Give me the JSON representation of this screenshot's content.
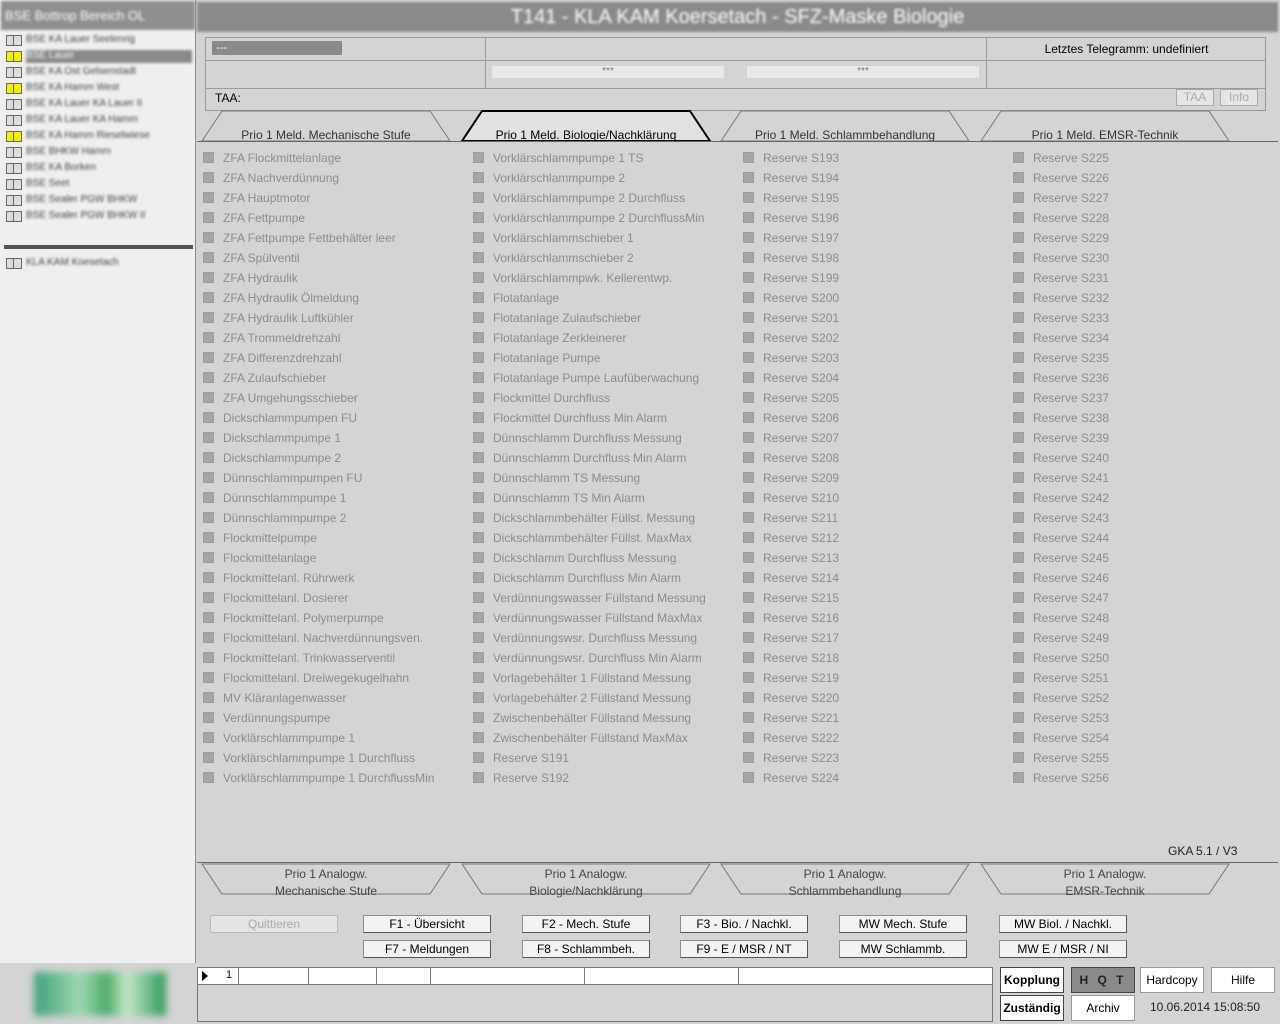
{
  "nav": {
    "header": "BSE Bottrop Bereich OL",
    "items": [
      {
        "label": "BSE KA Lauer Seelenrig",
        "state": "normal"
      },
      {
        "label": "BSE Lauer",
        "state": "selected-warning"
      },
      {
        "label": "BSE KA Ost Gelsenstadt",
        "state": "normal"
      },
      {
        "label": "BSE KA Hamm West",
        "state": "warning"
      },
      {
        "label": "BSE KA Lauer KA Lauer II",
        "state": "normal"
      },
      {
        "label": "BSE KA Lauer KA Hamm",
        "state": "normal"
      },
      {
        "label": "BSE KA Hamm Rieselwiese",
        "state": "warning"
      },
      {
        "label": "BSE BHKW Hamm",
        "state": "normal"
      },
      {
        "label": "BSE KA Borken",
        "state": "normal"
      },
      {
        "label": "BSE Seet",
        "state": "normal"
      },
      {
        "label": "BSE Sealer PGW BHKW",
        "state": "normal"
      },
      {
        "label": "BSE Sealer PGW BHKW II",
        "state": "normal"
      }
    ],
    "extra_item": "KLA KAM Koesetach"
  },
  "window_title": "T141 - KLA KAM Koersetach - SFZ-Maske Biologie",
  "info": {
    "field1": "---",
    "telegram": "Letztes Telegramm: undefiniert",
    "star1": "***",
    "star2": "***",
    "taa_label": "TAA:",
    "taa_button": "TAA",
    "info_button": "Info"
  },
  "tabs_top": [
    {
      "label": "Prio 1 Meld. Mechanische Stufe",
      "active": false
    },
    {
      "label": "Prio 1 Meld. Biologie/Nachklärung",
      "active": true
    },
    {
      "label": "Prio 1 Meld. Schlammbehandlung",
      "active": false
    },
    {
      "label": "Prio 1 Meld. EMSR-Technik",
      "active": false
    }
  ],
  "columns": [
    [
      "ZFA Flockmittelanlage",
      "ZFA Nachverdünnung",
      "ZFA Hauptmotor",
      "ZFA Fettpumpe",
      "ZFA Fettpumpe Fettbehälter leer",
      "ZFA Spülventil",
      "ZFA Hydraulik",
      "ZFA Hydraulik Ölmeldung",
      "ZFA Hydraulik Luftkühler",
      "ZFA Trommeldrehzahl",
      "ZFA Differenzdrehzahl",
      "ZFA Zulaufschieber",
      "ZFA Umgehungsschieber",
      "Dickschlammpumpen FU",
      "Dickschlammpumpe 1",
      "Dickschlammpumpe 2",
      "Dünnschlammpumpen FU",
      "Dünnschlammpumpe 1",
      "Dünnschlammpumpe 2",
      "Flockmittelpumpe",
      "Flockmittelanlage",
      "Flockmittelanl. Rührwerk",
      "Flockmittelanl. Dosierer",
      "Flockmittelanl. Polymerpumpe",
      "Flockmittelanl. Nachverdünnungsven.",
      "Flockmittelanl. Trinkwasserventil",
      "Flockmittelanl. Dreiwegekugelhahn",
      "MV Kläranlagenwasser",
      "Verdünnungspumpe",
      "Vorklärschlammpumpe 1",
      "Vorklärschlammpumpe 1 Durchfluss",
      "Vorklärschlammpumpe 1 DurchflussMin"
    ],
    [
      "Vorklärschlammpumpe 1 TS",
      "Vorklärschlammpumpe 2",
      "Vorklärschlammpumpe 2 Durchfluss",
      "Vorklärschlammpumpe 2 DurchflussMin",
      "Vorklärschlammschieber 1",
      "Vorklärschlammschieber 2",
      "Vorklärschlammpwk. Kellerentwp.",
      "Flotatanlage",
      "Flotatanlage Zulaufschieber",
      "Flotatanlage Zerkleinerer",
      "Flotatanlage Pumpe",
      "Flotatanlage Pumpe Laufüberwachung",
      "Flockmittel Durchfluss",
      "Flockmittel Durchfluss Min Alarm",
      "Dünnschlamm Durchfluss Messung",
      "Dünnschlamm Durchfluss Min Alarm",
      "Dünnschlamm TS Messung",
      "Dünnschlamm TS Min Alarm",
      "Dickschlammbehälter Füllst. Messung",
      "Dickschlammbehälter Füllst. MaxMax",
      "Dickschlamm Durchfluss Messung",
      "Dickschlamm Durchfluss Min Alarm",
      "Verdünnungswasser Füllstand Messung",
      "Verdünnungswasser Füllstand MaxMax",
      "Verdünnungswsr. Durchfluss Messung",
      "Verdünnungswsr. Durchfluss Min Alarm",
      "Vorlagebehälter 1 Füllstand Messung",
      "Vorlagebehälter 2 Füllstand Messung",
      "Zwischenbehälter Füllstand Messung",
      "Zwischenbehälter Füllstand MaxMax",
      "Reserve S191",
      "Reserve S192"
    ],
    [
      "Reserve S193",
      "Reserve S194",
      "Reserve S195",
      "Reserve S196",
      "Reserve S197",
      "Reserve S198",
      "Reserve S199",
      "Reserve S200",
      "Reserve S201",
      "Reserve S202",
      "Reserve S203",
      "Reserve S204",
      "Reserve S205",
      "Reserve S206",
      "Reserve S207",
      "Reserve S208",
      "Reserve S209",
      "Reserve S210",
      "Reserve S211",
      "Reserve S212",
      "Reserve S213",
      "Reserve S214",
      "Reserve S215",
      "Reserve S216",
      "Reserve S217",
      "Reserve S218",
      "Reserve S219",
      "Reserve S220",
      "Reserve S221",
      "Reserve S222",
      "Reserve S223",
      "Reserve S224"
    ],
    [
      "Reserve S225",
      "Reserve S226",
      "Reserve S227",
      "Reserve S228",
      "Reserve S229",
      "Reserve S230",
      "Reserve S231",
      "Reserve S232",
      "Reserve S233",
      "Reserve S234",
      "Reserve S235",
      "Reserve S236",
      "Reserve S237",
      "Reserve S238",
      "Reserve S239",
      "Reserve S240",
      "Reserve S241",
      "Reserve S242",
      "Reserve S243",
      "Reserve S244",
      "Reserve S245",
      "Reserve S246",
      "Reserve S247",
      "Reserve S248",
      "Reserve S249",
      "Reserve S250",
      "Reserve S251",
      "Reserve S252",
      "Reserve S253",
      "Reserve S254",
      "Reserve S255",
      "Reserve S256"
    ]
  ],
  "version": "GKA 5.1 / V3",
  "tabs_bottom": [
    {
      "line1": "Prio 1 Analogw.",
      "line2": "Mechanische Stufe"
    },
    {
      "line1": "Prio 1 Analogw.",
      "line2": "Biologie/Nachklärung"
    },
    {
      "line1": "Prio 1 Analogw.",
      "line2": "Schlammbehandlung"
    },
    {
      "line1": "Prio 1 Analogw.",
      "line2": "EMSR-Technik"
    }
  ],
  "buttons": {
    "quit": "Quittieren",
    "f1": "F1 - Übersicht",
    "f2": "F2 - Mech. Stufe",
    "f3": "F3 - Bio. / Nachkl.",
    "mw_mech": "MW  Mech. Stufe",
    "mw_biol": "MW  Biol. / Nachkl.",
    "f7": "F7 - Meldungen",
    "f8": "F8 - Schlammbeh.",
    "f9": "F9 - E / MSR / NT",
    "mw_schlamm": "MW  Schlammb.",
    "mw_emsr": "MW  E / MSR / NI"
  },
  "message_bar": {
    "row_number": "1"
  },
  "status": {
    "kopplung": "Kopplung",
    "hqt": "H Q T",
    "hardcopy": "Hardcopy",
    "hilfe": "Hilfe",
    "zustaendig": "Zuständig",
    "archiv": "Archiv",
    "datetime": "10.06.2014 15:08:50"
  }
}
